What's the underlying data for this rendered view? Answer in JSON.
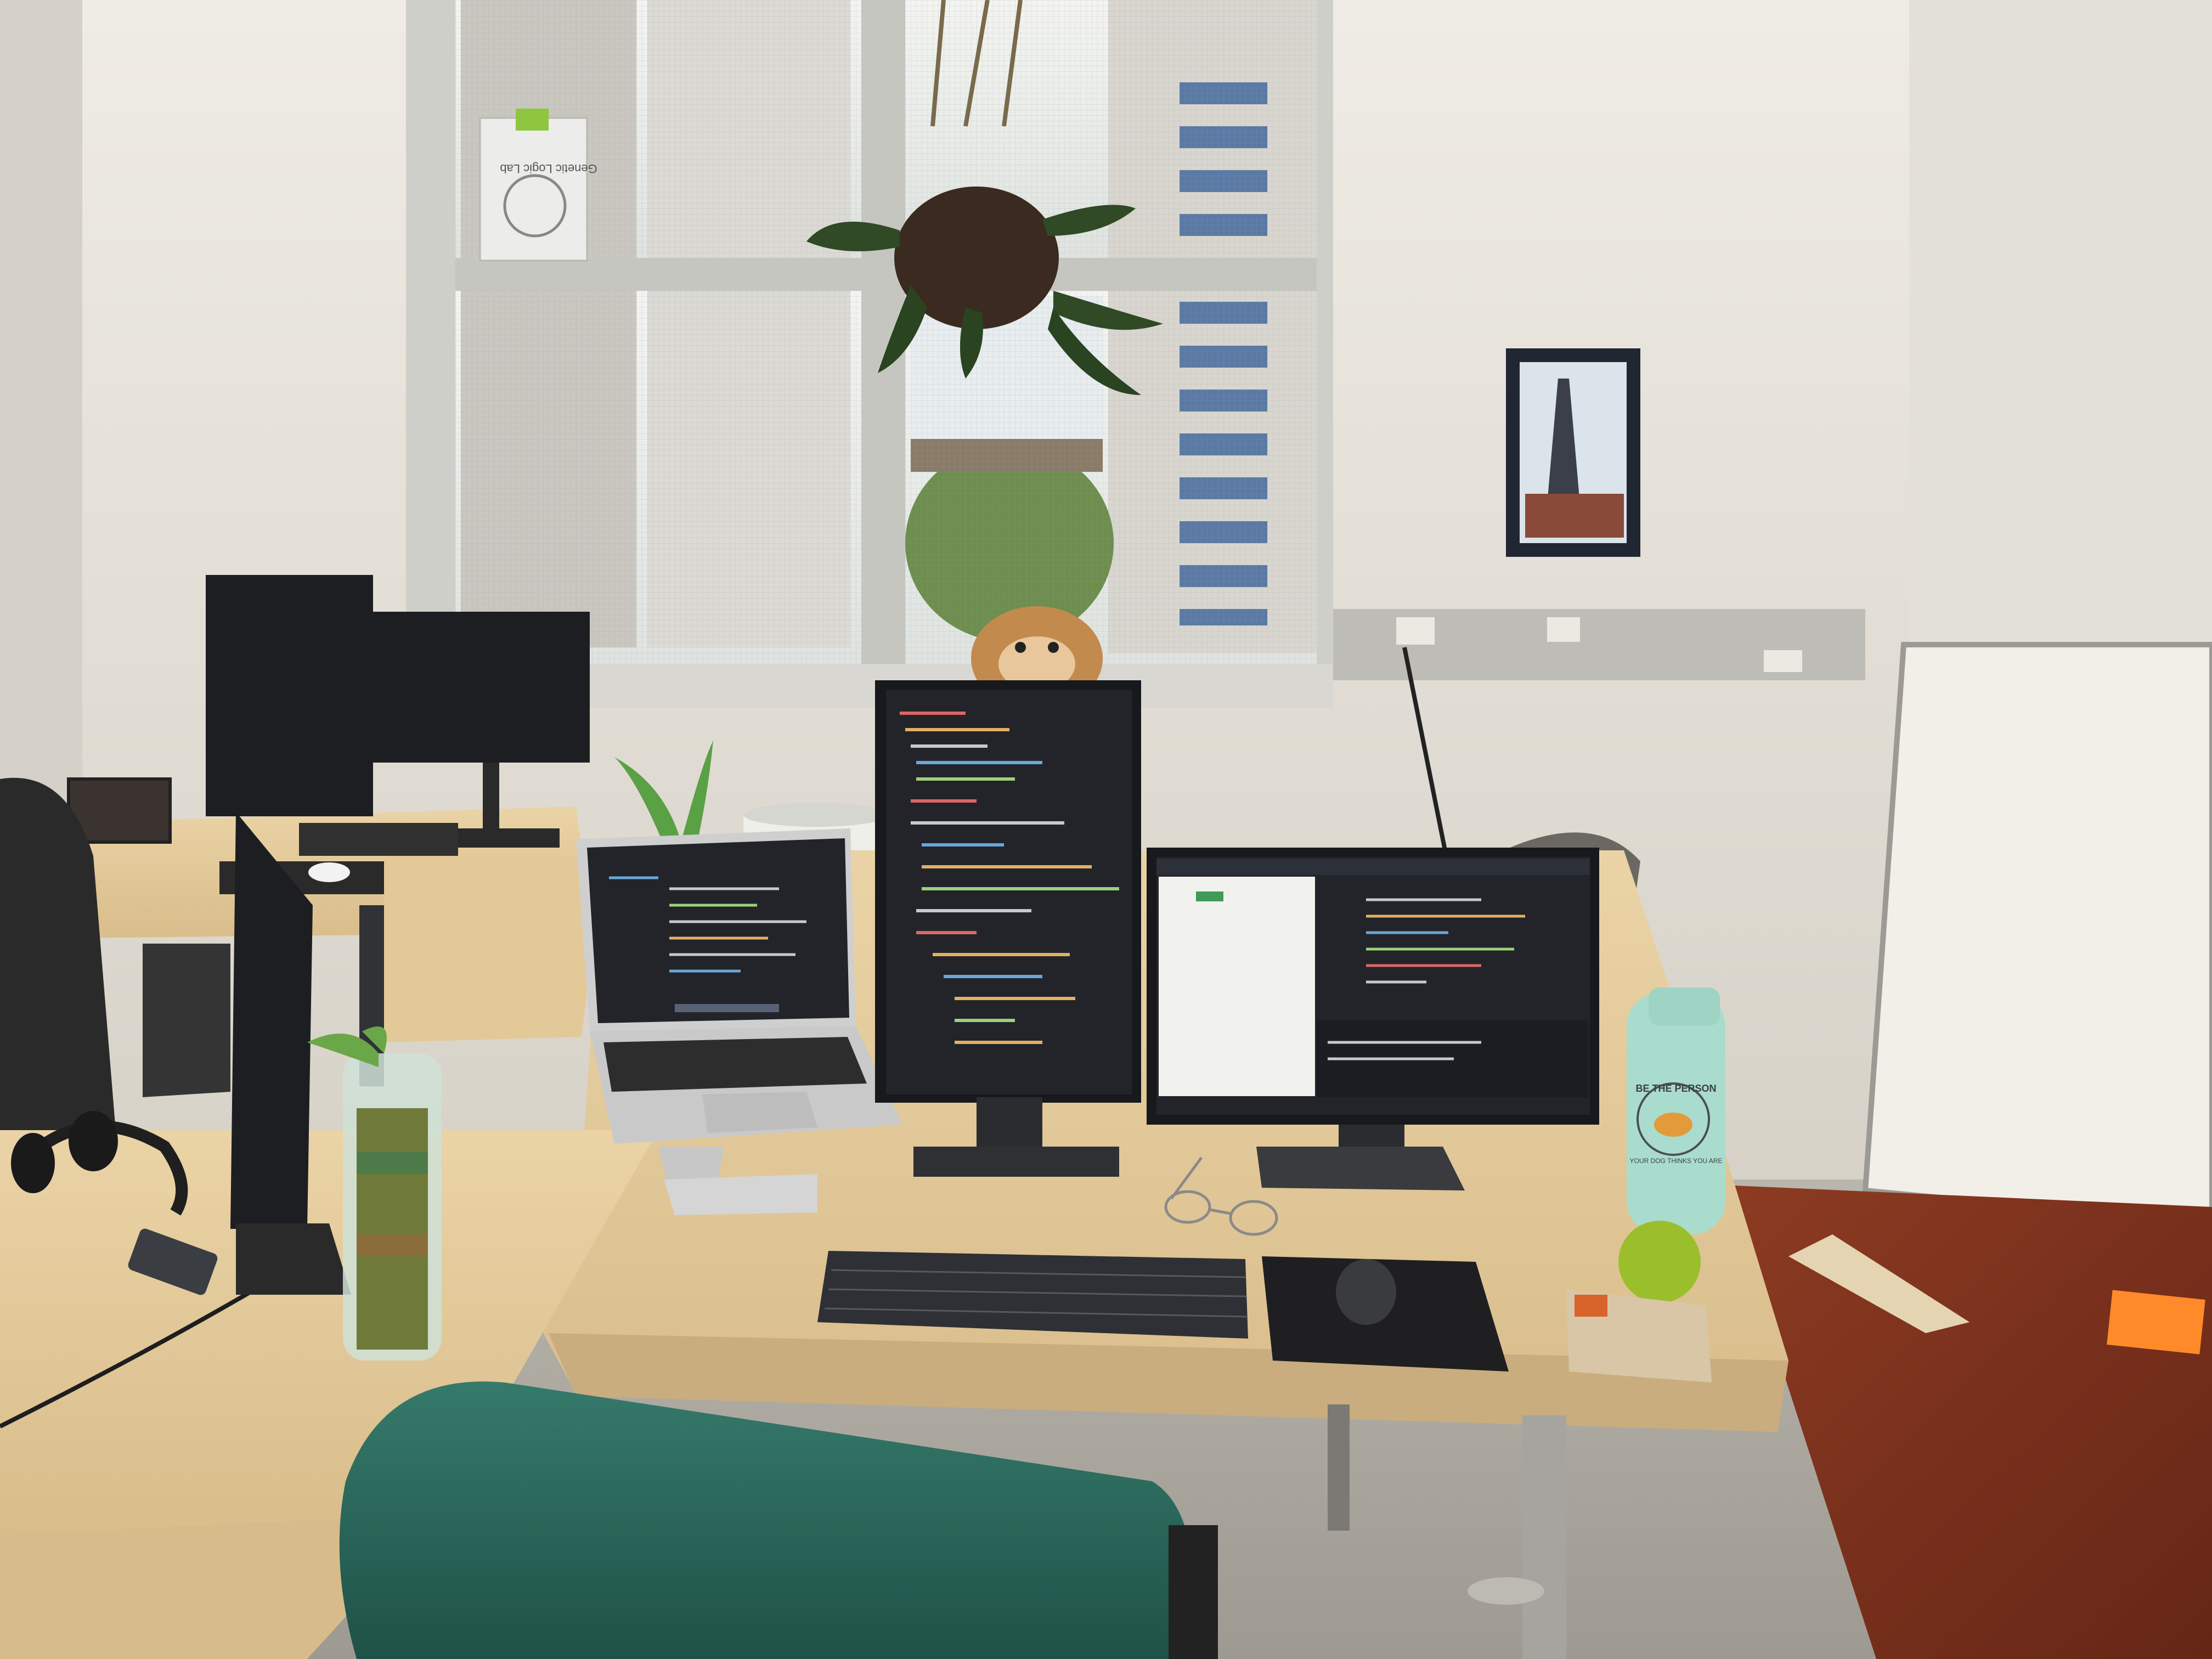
{
  "scene": {
    "window_sign_text": "Genetic Logic Lab",
    "bottle_text_top": "BE THE PERSON",
    "bottle_text_bottom": "YOUR DOG THINKS YOU ARE"
  },
  "colors": {
    "wall": "#e7e4dc",
    "desk": "#e2c99a",
    "desk_edge": "#c9ad7e",
    "red_desk": "#7a2f1c",
    "window_frame": "#cfcfca",
    "monitor": "#1b1c1f",
    "code_bg": "#22242a",
    "chair_green": "#2d6b5e",
    "bottle": "#a9dccd",
    "sticky_note": "#ff8a2a"
  }
}
